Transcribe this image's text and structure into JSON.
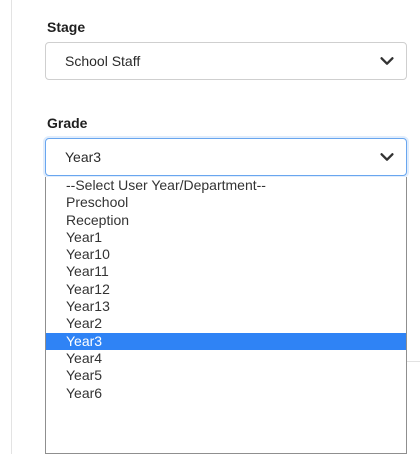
{
  "form": {
    "stage": {
      "label": "Stage",
      "value": "School Staff"
    },
    "grade": {
      "label": "Grade",
      "value": "Year3",
      "options": [
        "--Select User Year/Department--",
        "Preschool",
        "Reception",
        "Year1",
        "Year10",
        "Year11",
        "Year12",
        "Year13",
        "Year2",
        "Year3",
        "Year4",
        "Year5",
        "Year6"
      ],
      "selected_option": "Year3"
    }
  },
  "icons": {
    "dropdown": "chevron-down-icon"
  },
  "colors": {
    "focus_border": "#69a6ef",
    "selected_option_bg": "#2f83f5",
    "selected_option_text": "#ffffff"
  }
}
